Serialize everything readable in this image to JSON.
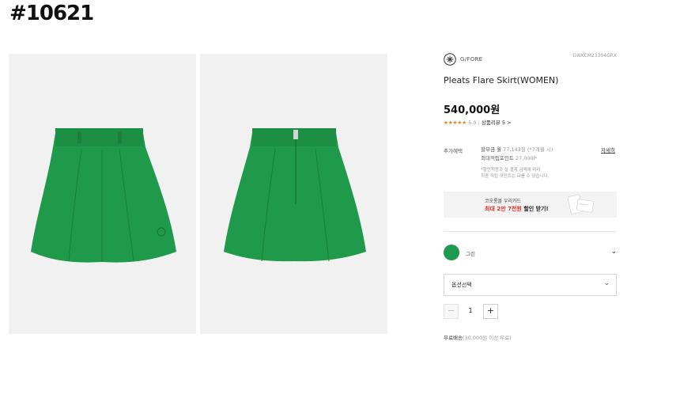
{
  "page_id": "#10621",
  "brand": {
    "name": "G/FORE",
    "sku": "GWKCM23304GRX"
  },
  "product": {
    "title": "Pleats Flare Skirt(WOMEN)",
    "price": "540,000원",
    "rating_stars": "★★★★★",
    "rating_score": "5.0",
    "review_link": "상품리뷰 5 >"
  },
  "benefits": {
    "label": "추가혜택",
    "installment": "할부금 월",
    "installment_amount": "77,143원 (*7개월 시)",
    "points_label": "최대적립포인트",
    "points_amount": "27,000P",
    "note_line1": "*할인적용과 실 결제 금액에 따라",
    "note_line2": "최종 적립 포인트는 다를 수 있습니다.",
    "detail_link": "자세히"
  },
  "card_banner": {
    "line1": "코오롱몰 우리카드",
    "line2_red": "최대 2만 7천원",
    "line2_rest": " 할인 받기!"
  },
  "color_option": {
    "label": "그린",
    "swatch_color": "#1d9a4d"
  },
  "option_select": {
    "placeholder": "옵션선택"
  },
  "quantity": {
    "minus": "−",
    "value": "1",
    "plus": "+"
  },
  "shipping": {
    "label": "무료배송",
    "condition": "(30,000원 이상 무료)"
  },
  "icons": {
    "color_chevron": "chevron-down-icon",
    "select_chevron": "chevron-down-icon",
    "brand_logo": "gfore-logo-icon"
  }
}
